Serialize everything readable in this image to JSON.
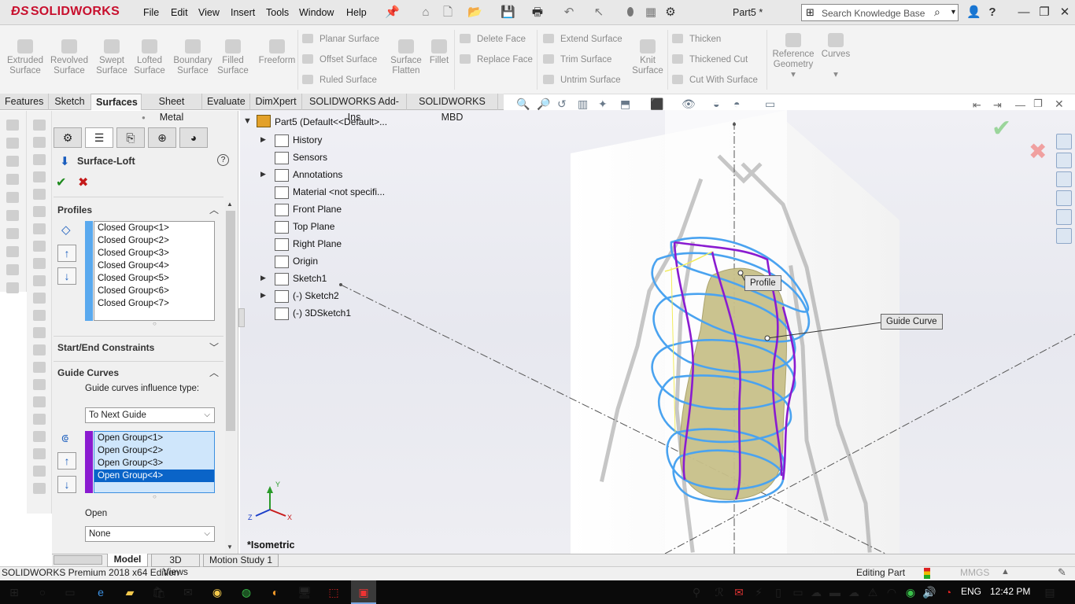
{
  "app": {
    "brand": "SOLIDWORKS",
    "doc_title": "Part5 *",
    "menus": [
      "File",
      "Edit",
      "View",
      "Insert",
      "Tools",
      "Window",
      "Help"
    ],
    "search_placeholder": "Search Knowledge Base"
  },
  "ribbon": {
    "big_buttons": [
      {
        "label1": "Extruded",
        "label2": "Surface",
        "icon": "extruded-surface-icon"
      },
      {
        "label1": "Revolved",
        "label2": "Surface",
        "icon": "revolved-surface-icon"
      },
      {
        "label1": "Swept",
        "label2": "Surface",
        "icon": "swept-surface-icon"
      },
      {
        "label1": "Lofted",
        "label2": "Surface",
        "icon": "lofted-surface-icon"
      },
      {
        "label1": "Boundary",
        "label2": "Surface",
        "icon": "boundary-surface-icon"
      },
      {
        "label1": "Filled",
        "label2": "Surface",
        "icon": "filled-surface-icon"
      },
      {
        "label1": "Freeform",
        "label2": "",
        "icon": "freeform-icon"
      }
    ],
    "col1": [
      "Planar Surface",
      "Offset Surface",
      "Ruled Surface"
    ],
    "surface_flatten": {
      "label1": "Surface",
      "label2": "Flatten"
    },
    "fillet": "Fillet",
    "col2": [
      "Delete Face",
      "Replace Face"
    ],
    "col3": [
      "Extend Surface",
      "Trim Surface",
      "Untrim Surface"
    ],
    "knit": {
      "label1": "Knit",
      "label2": "Surface"
    },
    "col4": [
      "Thicken",
      "Thickened Cut",
      "Cut With Surface"
    ],
    "reference": {
      "label1": "Reference",
      "label2": "Geometry"
    },
    "curves": "Curves"
  },
  "command_tabs": [
    "Features",
    "Sketch",
    "Surfaces",
    "Sheet Metal",
    "Evaluate",
    "DimXpert",
    "SOLIDWORKS Add-Ins",
    "SOLIDWORKS MBD"
  ],
  "active_tab": "Surfaces",
  "property_manager": {
    "title": "Surface-Loft",
    "profiles_title": "Profiles",
    "profiles": [
      "Closed Group<1>",
      "Closed Group<2>",
      "Closed Group<3>",
      "Closed Group<4>",
      "Closed Group<5>",
      "Closed Group<6>",
      "Closed Group<7>"
    ],
    "constraints_title": "Start/End Constraints",
    "guide_title": "Guide Curves",
    "guide_influence_label": "Guide curves influence type:",
    "guide_influence_value": "To Next Guide",
    "guides": [
      "Open Group<1>",
      "Open Group<2>",
      "Open Group<3>",
      "Open Group<4>"
    ],
    "guide_selected_index": 3,
    "open_label": "Open",
    "open_value": "None"
  },
  "tree": {
    "root": "Part5  (Default<<Default>...",
    "items": [
      {
        "label": "History",
        "expand": "▶"
      },
      {
        "label": "Sensors",
        "expand": ""
      },
      {
        "label": "Annotations",
        "expand": "▶"
      },
      {
        "label": "Material <not specifi...",
        "expand": ""
      },
      {
        "label": "Front Plane",
        "expand": ""
      },
      {
        "label": "Top Plane",
        "expand": ""
      },
      {
        "label": "Right Plane",
        "expand": ""
      },
      {
        "label": "Origin",
        "expand": ""
      },
      {
        "label": "Sketch1",
        "expand": "▶"
      },
      {
        "label": "(-) Sketch2",
        "expand": "▶"
      },
      {
        "label": "(-) 3DSketch1",
        "expand": ""
      }
    ]
  },
  "viewport": {
    "view_label": "*Isometric",
    "callout_profile": "Profile",
    "callout_guide": "Guide Curve",
    "triad": {
      "x": "X",
      "y": "Y",
      "z": "Z"
    },
    "colors": {
      "surface": "#c8c08a",
      "profile": "#4aa3f0",
      "guide": "#8a1bd0"
    }
  },
  "bottom_tabs": [
    "Model",
    "3D Views",
    "Motion Study 1"
  ],
  "bottom_active": "Model",
  "status": {
    "left": "SOLIDWORKS Premium 2018 x64 Edition",
    "editing": "Editing Part",
    "units": "MMGS"
  },
  "taskbar": {
    "lang": "ENG",
    "time": "12:42 PM"
  }
}
